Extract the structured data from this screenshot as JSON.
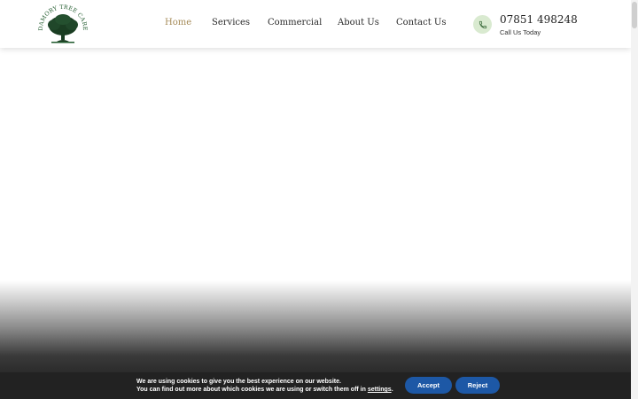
{
  "brand": {
    "logo_text": "DAMORY TREE CARE",
    "logo_color": "#1f5a2c"
  },
  "nav": {
    "items": [
      {
        "label": "Home",
        "active": true
      },
      {
        "label": "Services",
        "active": false
      },
      {
        "label": "Commercial",
        "active": false
      },
      {
        "label": "About Us",
        "active": false
      },
      {
        "label": "Contact Us",
        "active": false
      }
    ],
    "active_color": "#a58a57"
  },
  "contact": {
    "phone": "07851 498248",
    "subtitle": "Call Us Today",
    "icon": "phone-icon"
  },
  "cookie": {
    "line1": "We are using cookies to give you the best experience on our website.",
    "line2_prefix": "You can find out more about which cookies we are using or switch them off in ",
    "settings_link": "settings",
    "line2_suffix": ".",
    "accept_label": "Accept",
    "reject_label": "Reject",
    "button_color": "#1d58a6"
  }
}
